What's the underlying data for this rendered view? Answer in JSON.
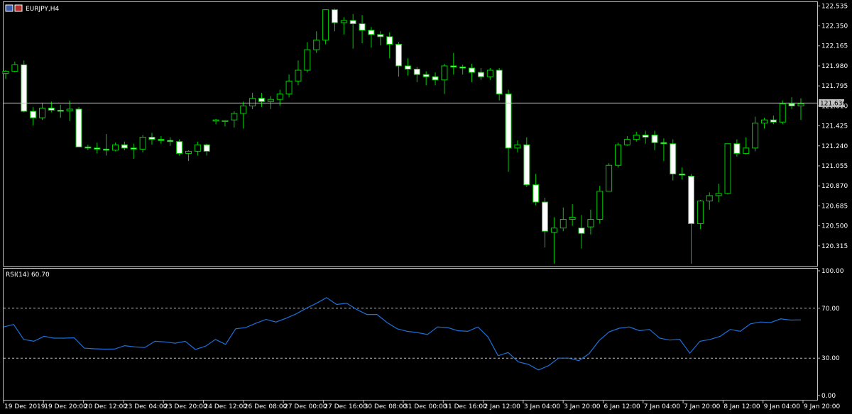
{
  "window": {
    "symbol_title": "EURJPY,H4"
  },
  "colors": {
    "background": "#000000",
    "frame": "#c0c0c0",
    "bull_candle": "#000000",
    "bear_candle": "#ffffff",
    "wick": "#00cc00",
    "rsi_line": "#1e6fd9",
    "level_line": "#c0c0c0",
    "current_price_label_bg": "#c0c0c0"
  },
  "chart_data": [
    {
      "type": "candlestick",
      "title": "EURJPY,H4",
      "current_price": 121.636,
      "current_price_label": "121.636",
      "ylim": [
        120.13,
        122.57
      ],
      "y_ticks": [
        "122.535",
        "122.350",
        "122.165",
        "121.980",
        "121.795",
        "121.610",
        "121.425",
        "121.240",
        "121.055",
        "120.870",
        "120.685",
        "120.500",
        "120.315"
      ],
      "x_tick_labels": [
        "19 Dec 2019",
        "19 Dec 20:00",
        "20 Dec 12:00",
        "23 Dec 04:00",
        "23 Dec 20:00",
        "24 Dec 12:00",
        "26 Dec 08:00",
        "27 Dec 00:00",
        "27 Dec 16:00",
        "30 Dec 08:00",
        "31 Dec 00:00",
        "31 Dec 16:00",
        "2 Jan 12:00",
        "3 Jan 04:00",
        "3 Jan 20:00",
        "6 Jan 12:00",
        "7 Jan 04:00",
        "7 Jan 20:00",
        "8 Jan 12:00",
        "9 Jan 04:00",
        "9 Jan 20:00"
      ],
      "candles": [
        {
          "o": 121.91,
          "h": 121.94,
          "l": 121.86,
          "c": 121.93
        },
        {
          "o": 121.93,
          "h": 122.02,
          "l": 121.92,
          "c": 121.99
        },
        {
          "o": 121.99,
          "h": 122.03,
          "l": 121.55,
          "c": 121.56
        },
        {
          "o": 121.56,
          "h": 121.6,
          "l": 121.43,
          "c": 121.5
        },
        {
          "o": 121.5,
          "h": 121.64,
          "l": 121.48,
          "c": 121.59
        },
        {
          "o": 121.59,
          "h": 121.65,
          "l": 121.55,
          "c": 121.57
        },
        {
          "o": 121.57,
          "h": 121.62,
          "l": 121.5,
          "c": 121.565
        },
        {
          "o": 121.565,
          "h": 121.66,
          "l": 121.47,
          "c": 121.58
        },
        {
          "o": 121.58,
          "h": 121.6,
          "l": 121.38,
          "c": 121.23
        },
        {
          "o": 121.23,
          "h": 121.25,
          "l": 121.2,
          "c": 121.22
        },
        {
          "o": 121.22,
          "h": 121.27,
          "l": 121.17,
          "c": 121.21
        },
        {
          "o": 121.21,
          "h": 121.35,
          "l": 121.15,
          "c": 121.2
        },
        {
          "o": 121.2,
          "h": 121.27,
          "l": 121.19,
          "c": 121.25
        },
        {
          "o": 121.25,
          "h": 121.28,
          "l": 121.2,
          "c": 121.22
        },
        {
          "o": 121.22,
          "h": 121.26,
          "l": 121.12,
          "c": 121.21
        },
        {
          "o": 121.21,
          "h": 121.34,
          "l": 121.18,
          "c": 121.32
        },
        {
          "o": 121.32,
          "h": 121.36,
          "l": 121.25,
          "c": 121.3
        },
        {
          "o": 121.3,
          "h": 121.33,
          "l": 121.26,
          "c": 121.29
        },
        {
          "o": 121.29,
          "h": 121.32,
          "l": 121.24,
          "c": 121.28
        },
        {
          "o": 121.28,
          "h": 121.3,
          "l": 121.15,
          "c": 121.17
        },
        {
          "o": 121.17,
          "h": 121.2,
          "l": 121.1,
          "c": 121.19
        },
        {
          "o": 121.19,
          "h": 121.28,
          "l": 121.15,
          "c": 121.25
        },
        {
          "o": 121.25,
          "h": 121.26,
          "l": 121.15,
          "c": 121.19
        },
        {
          "o": 121.47,
          "h": 121.49,
          "l": 121.44,
          "c": 121.48
        },
        {
          "o": 121.47,
          "h": 121.48,
          "l": 121.42,
          "c": 121.475
        },
        {
          "o": 121.48,
          "h": 121.56,
          "l": 121.41,
          "c": 121.54
        },
        {
          "o": 121.54,
          "h": 121.65,
          "l": 121.4,
          "c": 121.61
        },
        {
          "o": 121.61,
          "h": 121.73,
          "l": 121.58,
          "c": 121.68
        },
        {
          "o": 121.68,
          "h": 121.73,
          "l": 121.6,
          "c": 121.65
        },
        {
          "o": 121.65,
          "h": 121.7,
          "l": 121.58,
          "c": 121.67
        },
        {
          "o": 121.67,
          "h": 121.76,
          "l": 121.61,
          "c": 121.72
        },
        {
          "o": 121.72,
          "h": 121.9,
          "l": 121.69,
          "c": 121.84
        },
        {
          "o": 121.84,
          "h": 122.03,
          "l": 121.8,
          "c": 121.94
        },
        {
          "o": 121.94,
          "h": 122.2,
          "l": 121.92,
          "c": 122.13
        },
        {
          "o": 122.13,
          "h": 122.3,
          "l": 122.1,
          "c": 122.22
        },
        {
          "o": 122.22,
          "h": 122.42,
          "l": 122.18,
          "c": 122.5
        },
        {
          "o": 122.5,
          "h": 122.51,
          "l": 122.3,
          "c": 122.38
        },
        {
          "o": 122.38,
          "h": 122.43,
          "l": 122.27,
          "c": 122.4
        },
        {
          "o": 122.4,
          "h": 122.46,
          "l": 122.14,
          "c": 122.37
        },
        {
          "o": 122.37,
          "h": 122.45,
          "l": 122.19,
          "c": 122.31
        },
        {
          "o": 122.31,
          "h": 122.34,
          "l": 122.15,
          "c": 122.27
        },
        {
          "o": 122.27,
          "h": 122.3,
          "l": 122.17,
          "c": 122.25
        },
        {
          "o": 122.25,
          "h": 122.29,
          "l": 122.05,
          "c": 122.18
        },
        {
          "o": 122.18,
          "h": 122.2,
          "l": 121.88,
          "c": 121.98
        },
        {
          "o": 121.98,
          "h": 122.05,
          "l": 121.89,
          "c": 121.95
        },
        {
          "o": 121.95,
          "h": 121.97,
          "l": 121.83,
          "c": 121.9
        },
        {
          "o": 121.9,
          "h": 121.93,
          "l": 121.8,
          "c": 121.88
        },
        {
          "o": 121.88,
          "h": 121.92,
          "l": 121.8,
          "c": 121.85
        },
        {
          "o": 121.85,
          "h": 122.0,
          "l": 121.72,
          "c": 121.98
        },
        {
          "o": 121.98,
          "h": 122.1,
          "l": 121.9,
          "c": 121.97
        },
        {
          "o": 121.97,
          "h": 121.99,
          "l": 121.9,
          "c": 121.96
        },
        {
          "o": 121.96,
          "h": 122.0,
          "l": 121.83,
          "c": 121.92
        },
        {
          "o": 121.92,
          "h": 121.96,
          "l": 121.85,
          "c": 121.88
        },
        {
          "o": 121.88,
          "h": 121.96,
          "l": 121.85,
          "c": 121.94
        },
        {
          "o": 121.94,
          "h": 121.96,
          "l": 121.66,
          "c": 121.72
        },
        {
          "o": 121.72,
          "h": 121.76,
          "l": 121.0,
          "c": 121.22
        },
        {
          "o": 121.22,
          "h": 121.29,
          "l": 121.18,
          "c": 121.25
        },
        {
          "o": 121.25,
          "h": 121.32,
          "l": 120.86,
          "c": 120.88
        },
        {
          "o": 120.88,
          "h": 120.98,
          "l": 120.69,
          "c": 120.72
        },
        {
          "o": 120.72,
          "h": 120.76,
          "l": 120.3,
          "c": 120.45
        },
        {
          "o": 120.44,
          "h": 120.58,
          "l": 120.15,
          "c": 120.48
        },
        {
          "o": 120.48,
          "h": 120.67,
          "l": 120.45,
          "c": 120.56
        },
        {
          "o": 120.56,
          "h": 120.7,
          "l": 120.5,
          "c": 120.58
        },
        {
          "o": 120.48,
          "h": 120.6,
          "l": 120.29,
          "c": 120.43
        },
        {
          "o": 120.49,
          "h": 120.65,
          "l": 120.42,
          "c": 120.56
        },
        {
          "o": 120.56,
          "h": 120.87,
          "l": 120.52,
          "c": 120.82
        },
        {
          "o": 120.82,
          "h": 121.08,
          "l": 120.82,
          "c": 121.06
        },
        {
          "o": 121.06,
          "h": 121.27,
          "l": 121.04,
          "c": 121.25
        },
        {
          "o": 121.25,
          "h": 121.33,
          "l": 121.24,
          "c": 121.3
        },
        {
          "o": 121.3,
          "h": 121.37,
          "l": 121.28,
          "c": 121.34
        },
        {
          "o": 121.34,
          "h": 121.38,
          "l": 121.26,
          "c": 121.32
        },
        {
          "o": 121.34,
          "h": 121.38,
          "l": 121.2,
          "c": 121.27
        },
        {
          "o": 121.27,
          "h": 121.31,
          "l": 121.1,
          "c": 121.26
        },
        {
          "o": 121.26,
          "h": 121.3,
          "l": 120.92,
          "c": 120.98
        },
        {
          "o": 120.98,
          "h": 121.04,
          "l": 120.93,
          "c": 120.97
        },
        {
          "o": 120.96,
          "h": 120.98,
          "l": 120.15,
          "c": 120.52
        },
        {
          "o": 120.52,
          "h": 120.74,
          "l": 120.47,
          "c": 120.73
        },
        {
          "o": 120.73,
          "h": 120.81,
          "l": 120.65,
          "c": 120.78
        },
        {
          "o": 120.78,
          "h": 120.89,
          "l": 120.72,
          "c": 120.8
        },
        {
          "o": 120.8,
          "h": 121.06,
          "l": 120.79,
          "c": 121.26
        },
        {
          "o": 121.26,
          "h": 121.3,
          "l": 121.14,
          "c": 121.17
        },
        {
          "o": 121.17,
          "h": 121.32,
          "l": 121.16,
          "c": 121.22
        },
        {
          "o": 121.22,
          "h": 121.51,
          "l": 121.19,
          "c": 121.45
        },
        {
          "o": 121.45,
          "h": 121.5,
          "l": 121.4,
          "c": 121.48
        },
        {
          "o": 121.48,
          "h": 121.52,
          "l": 121.44,
          "c": 121.46
        },
        {
          "o": 121.46,
          "h": 121.66,
          "l": 121.44,
          "c": 121.63
        },
        {
          "o": 121.63,
          "h": 121.69,
          "l": 121.58,
          "c": 121.61
        },
        {
          "o": 121.61,
          "h": 121.68,
          "l": 121.48,
          "c": 121.63
        }
      ]
    },
    {
      "type": "line",
      "title": "RSI(14) 60.70",
      "ylim": [
        0,
        100
      ],
      "y_ticks": [
        "100.00",
        "70.00",
        "30.00",
        "0.00"
      ],
      "levels": [
        70,
        30
      ],
      "series": [
        {
          "values": [
            55.0,
            57.0,
            45.0,
            43.5,
            47.5,
            46.0,
            46.0,
            46.3,
            38.0,
            37.5,
            37.2,
            37.3,
            40.0,
            39.0,
            38.5,
            43.5,
            43.0,
            42.0,
            43.5,
            37.0,
            39.5,
            45.0,
            41.0,
            53.5,
            54.5,
            58.0,
            61.0,
            59.0,
            62.0,
            65.5,
            70.0,
            74.0,
            78.5,
            73.0,
            74.0,
            69.0,
            65.0,
            65.0,
            58.5,
            53.5,
            51.5,
            50.5,
            49.0,
            55.0,
            54.5,
            52.0,
            51.5,
            55.0,
            47.0,
            32.0,
            34.5,
            27.0,
            25.0,
            20.5,
            24.0,
            30.0,
            30.0,
            28.0,
            33.5,
            44.0,
            51.0,
            54.0,
            55.0,
            52.0,
            53.0,
            46.0,
            44.5,
            45.0,
            34.0,
            43.5,
            45.0,
            47.5,
            53.0,
            51.5,
            57.5,
            59.0,
            58.5,
            61.5,
            60.5,
            60.7
          ]
        }
      ]
    }
  ]
}
